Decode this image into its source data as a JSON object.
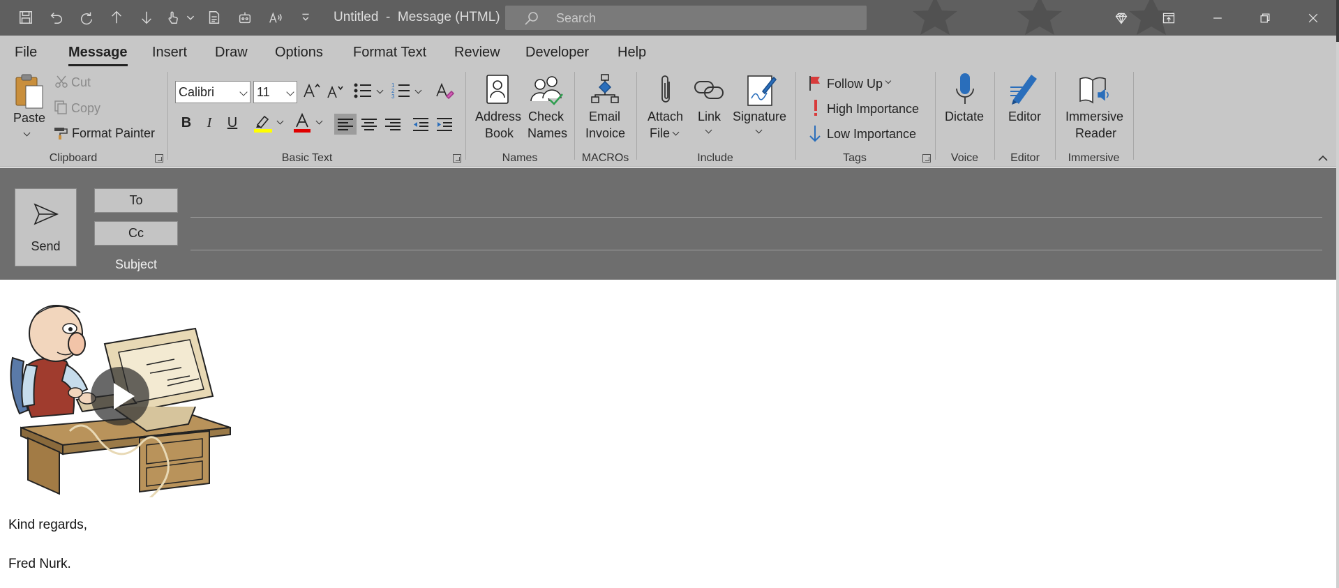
{
  "window": {
    "title": "Untitled  -  Message (HTML)",
    "search_placeholder": "Search"
  },
  "tabs": [
    {
      "label": "File"
    },
    {
      "label": "Message",
      "active": true
    },
    {
      "label": "Insert"
    },
    {
      "label": "Draw"
    },
    {
      "label": "Options"
    },
    {
      "label": "Format Text"
    },
    {
      "label": "Review"
    },
    {
      "label": "Developer"
    },
    {
      "label": "Help"
    }
  ],
  "ribbon": {
    "clipboard": {
      "paste": "Paste",
      "cut": "Cut",
      "copy": "Copy",
      "format_painter": "Format Painter",
      "group": "Clipboard"
    },
    "basic_text": {
      "font": "Calibri",
      "size": "11",
      "bold": "B",
      "italic": "I",
      "underline": "U",
      "group": "Basic Text"
    },
    "names": {
      "address_book_1": "Address",
      "address_book_2": "Book",
      "check_names_1": "Check",
      "check_names_2": "Names",
      "group": "Names"
    },
    "macros": {
      "email_invoice_1": "Email",
      "email_invoice_2": "Invoice",
      "group": "MACROs"
    },
    "include": {
      "attach_1": "Attach",
      "attach_2": "File",
      "link": "Link",
      "signature": "Signature",
      "group": "Include"
    },
    "tags": {
      "follow_up": "Follow Up",
      "high": "High Importance",
      "low": "Low Importance",
      "group": "Tags"
    },
    "voice": {
      "dictate": "Dictate",
      "group": "Voice"
    },
    "editor": {
      "editor": "Editor",
      "group": "Editor"
    },
    "immersive": {
      "reader_1": "Immersive",
      "reader_2": "Reader",
      "group": "Immersive"
    }
  },
  "header": {
    "send": "Send",
    "to": "To",
    "cc": "Cc",
    "subject": "Subject"
  },
  "body": {
    "line1": "Kind regards,",
    "line2": "Fred Nurk."
  },
  "colors": {
    "highlight": "#ffff00",
    "font_color": "#e00000",
    "flag": "#d83b3b",
    "accent_blue": "#2a6ebb"
  }
}
